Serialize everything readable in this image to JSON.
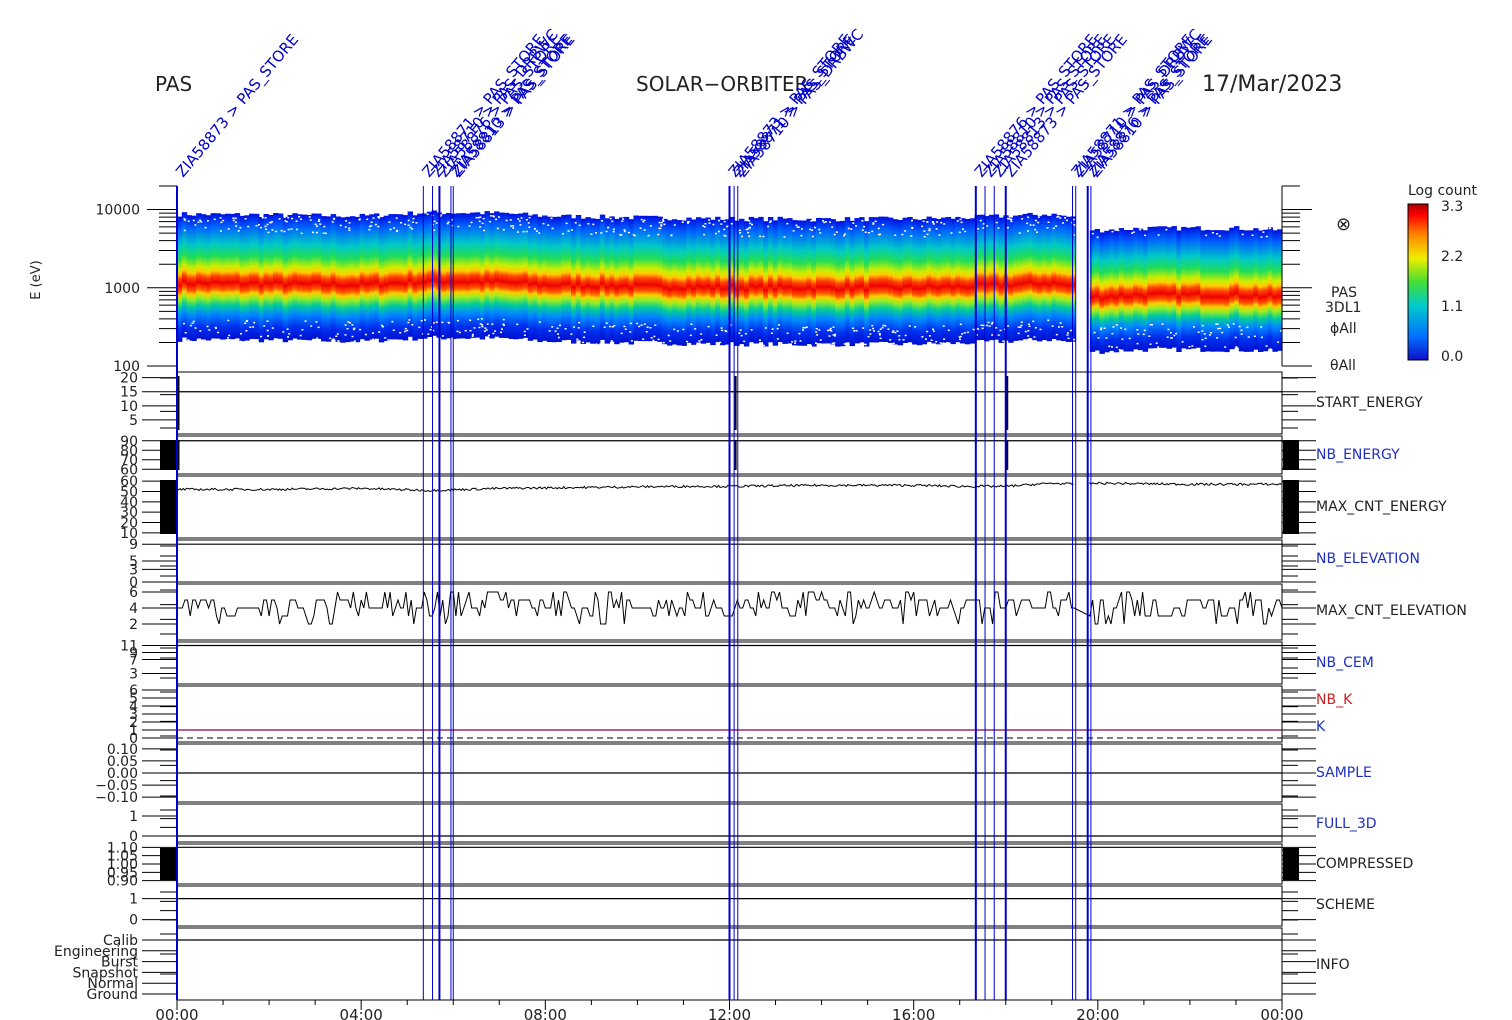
{
  "header": {
    "instrument": "PAS",
    "mission": "SOLAR−ORBITER",
    "date": "17/Mar/2023"
  },
  "markers": {
    "label_texts": [
      "ZIA58873 > PAS_STORE",
      "ZIA58871 > PAS_STORE",
      "ZIA58710 > PAS_DRBWC",
      "ZIA58876 > PAS_STORE",
      "ZIA58810 > PAS_STORE",
      "ZIA58813 > PAS_STORE"
    ],
    "times_hours": [
      0.0,
      5.35,
      5.55,
      5.7,
      5.95,
      6.0,
      12.0,
      12.1,
      12.18,
      17.35,
      17.55,
      17.75,
      18.0,
      19.45,
      19.52,
      19.78,
      19.85
    ]
  },
  "spectrogram": {
    "ylabel": "E (eV)",
    "y_ticks": [
      "10000",
      "1000",
      "100"
    ],
    "side_labels": [
      "PAS",
      "3DL1",
      "ϕAll",
      "θAll"
    ],
    "symbol": "⊗",
    "colorbar_title": "Log count",
    "colorbar_ticks": [
      "3.3",
      "2.2",
      "1.1",
      "0.0"
    ]
  },
  "colors": {
    "marker": "#0000cc",
    "label_blue": "#1f2fbf",
    "label_red": "#cc2222",
    "k_line": "#880044"
  },
  "chart_data": {
    "type": "heatmap",
    "x_range_hours": [
      0,
      24
    ],
    "x_ticks": [
      "00:00",
      "04:00",
      "08:00",
      "12:00",
      "16:00",
      "20:00",
      "00:00"
    ],
    "energy_range_ev": [
      100,
      20000
    ],
    "z_range_log_count": [
      0.0,
      3.3
    ],
    "data_gap_hours": [
      19.5,
      19.8
    ],
    "peak_energy_profile": {
      "hours": [
        0,
        2,
        4,
        5.5,
        7,
        8,
        10,
        12,
        14,
        16,
        17,
        18,
        19,
        19.5,
        20,
        21,
        22,
        23,
        24
      ],
      "energy_ev": [
        950,
        930,
        900,
        1000,
        980,
        900,
        860,
        830,
        820,
        830,
        850,
        900,
        950,
        850,
        800,
        850,
        850,
        850,
        800
      ]
    },
    "panels": [
      {
        "name": "START_ENERGY",
        "label_color": "black",
        "ticks": [
          "20",
          "15",
          "10",
          "5"
        ],
        "y_range": [
          0,
          22
        ],
        "base_value": 15,
        "spikes_hours": [
          0.0,
          12.1,
          18.0
        ]
      },
      {
        "name": "NB_ENERGY",
        "label_color": "blue",
        "ticks": [
          "90",
          "80",
          "70",
          "60"
        ],
        "y_range": [
          55,
          95
        ],
        "base_value": 90,
        "spikes_hours": [
          0.0,
          12.1,
          18.0
        ]
      },
      {
        "name": "MAX_CNT_ENERGY",
        "label_color": "black",
        "ticks": [
          "60",
          "50",
          "40",
          "30",
          "20",
          "10"
        ],
        "y_range": [
          5,
          65
        ],
        "trace": {
          "hours": [
            0,
            2,
            4,
            5.5,
            7,
            9,
            11,
            12,
            14,
            16,
            17,
            18,
            19,
            19.5,
            20,
            22,
            24
          ],
          "values": [
            52,
            52,
            53,
            51,
            53,
            54,
            55,
            55,
            56,
            56,
            55,
            55,
            58,
            57,
            58,
            57,
            57
          ]
        }
      },
      {
        "name": "NB_ELEVATION",
        "label_color": "blue",
        "ticks": [
          "9",
          "5",
          "3",
          "0"
        ],
        "y_range": [
          0,
          10
        ],
        "base_value": 9
      },
      {
        "name": "MAX_CNT_ELEVATION",
        "label_color": "black",
        "ticks": [
          "6",
          "4",
          "2"
        ],
        "y_range": [
          0,
          7
        ],
        "levels": [
          2,
          3,
          4,
          5,
          6
        ],
        "typical_value": 4
      },
      {
        "name": "NB_CEM",
        "label_color": "blue",
        "ticks": [
          "11",
          "9",
          "7",
          "3"
        ],
        "y_range": [
          0,
          12
        ],
        "base_value": 11
      },
      {
        "name": "NB_K",
        "label_color": "red",
        "ticks": [
          "6",
          "5",
          "4",
          "3",
          "2",
          "1",
          "0"
        ],
        "y_range": [
          -0.5,
          6.5
        ],
        "base_value": 1,
        "dashed_value": 0
      },
      {
        "name": "K",
        "label_color": "blue"
      },
      {
        "name": "SAMPLE",
        "label_color": "blue",
        "ticks": [
          "0.10",
          "0.05",
          "0.00",
          "−0.05",
          "−0.10"
        ],
        "y_range": [
          -0.12,
          0.12
        ],
        "base_value": 0.0
      },
      {
        "name": "FULL_3D",
        "label_color": "blue",
        "ticks": [
          "1",
          "0"
        ],
        "y_range": [
          -0.3,
          1.6
        ],
        "base_value": 0
      },
      {
        "name": "COMPRESSED",
        "label_color": "black",
        "ticks": [
          "1.10",
          "1.05",
          "1.00",
          "0.95",
          "0.90"
        ],
        "y_range": [
          0.88,
          1.12
        ],
        "base_value": 1.1
      },
      {
        "name": "SCHEME",
        "label_color": "black",
        "ticks": [
          "1",
          "0"
        ],
        "y_range": [
          -0.3,
          1.6
        ],
        "base_value": 1
      },
      {
        "name": "INFO",
        "label_color": "black",
        "ticks": [
          "Calib",
          "Engineering",
          "Burst",
          "Snapshot",
          "Normal",
          "Ground"
        ],
        "base_value": "Calib"
      }
    ]
  }
}
